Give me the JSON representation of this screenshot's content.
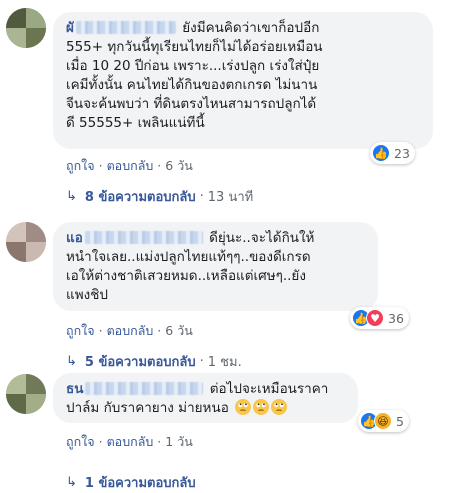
{
  "comments": [
    {
      "author_visible": "ผั",
      "text_lines": [
        "ยังมีคนคิดว่าเขาก็อปอีก",
        "555+ ทุกวันนี้ทุเรียนไทยก็ไม่ได้อร่อยเหมือน",
        "เมื่อ 10 20 ปีก่อน เพราะ...เร่งปลูก เร่งใส่ปุ๋ย",
        "เคมีทั้งนั้น คนไทยได้กินของตกเกรด ไม่นาน",
        "จีนจะค้นพบว่า ที่ดินตรงไหนสามารถปลูกได้",
        "ดี 55555+ เพลินแน่ทีนี้"
      ],
      "like_label": "ถูกใจ",
      "reply_label": "ตอบกลับ",
      "time": "6 วัน",
      "reaction_count": "23",
      "replies_label": "8 ข้อความตอบกลับ",
      "replies_time": "13 นาที"
    },
    {
      "author_visible": "แอ",
      "text_lines": [
        "ดียุ่นะ..จะได้กินให้",
        "หนำใจเลย..แม่งปลูกไทยแท้ๆๆ..ของดีเกรด",
        "เอให้ต่างชาติเสวยหมด..เหลือแต่เศษๆ..ยัง",
        "แพงชิป"
      ],
      "like_label": "ถูกใจ",
      "reply_label": "ตอบกลับ",
      "time": "6 วัน",
      "reaction_count": "36",
      "replies_label": "5 ข้อความตอบกลับ",
      "replies_time": "1 ชม."
    },
    {
      "author_visible": "ธน",
      "text_lines": [
        "ต่อไปจะเหมือนราคา",
        "ปาล์ม กับราคายาง ม่ายหนอ"
      ],
      "like_label": "ถูกใจ",
      "reply_label": "ตอบกลับ",
      "time": "1 วัน",
      "reaction_count": "5",
      "replies_label": "1 ข้อความตอบกลับ",
      "replies_time": ""
    }
  ],
  "colors": {
    "link": "#385898",
    "bubble": "#f2f3f5",
    "like": "#1877f2",
    "love": "#f33e58",
    "haha": "#f7b125"
  },
  "icons": [
    "like-icon",
    "love-icon",
    "haha-icon",
    "reply-arrow-icon",
    "rolling-eyes-emoji"
  ]
}
